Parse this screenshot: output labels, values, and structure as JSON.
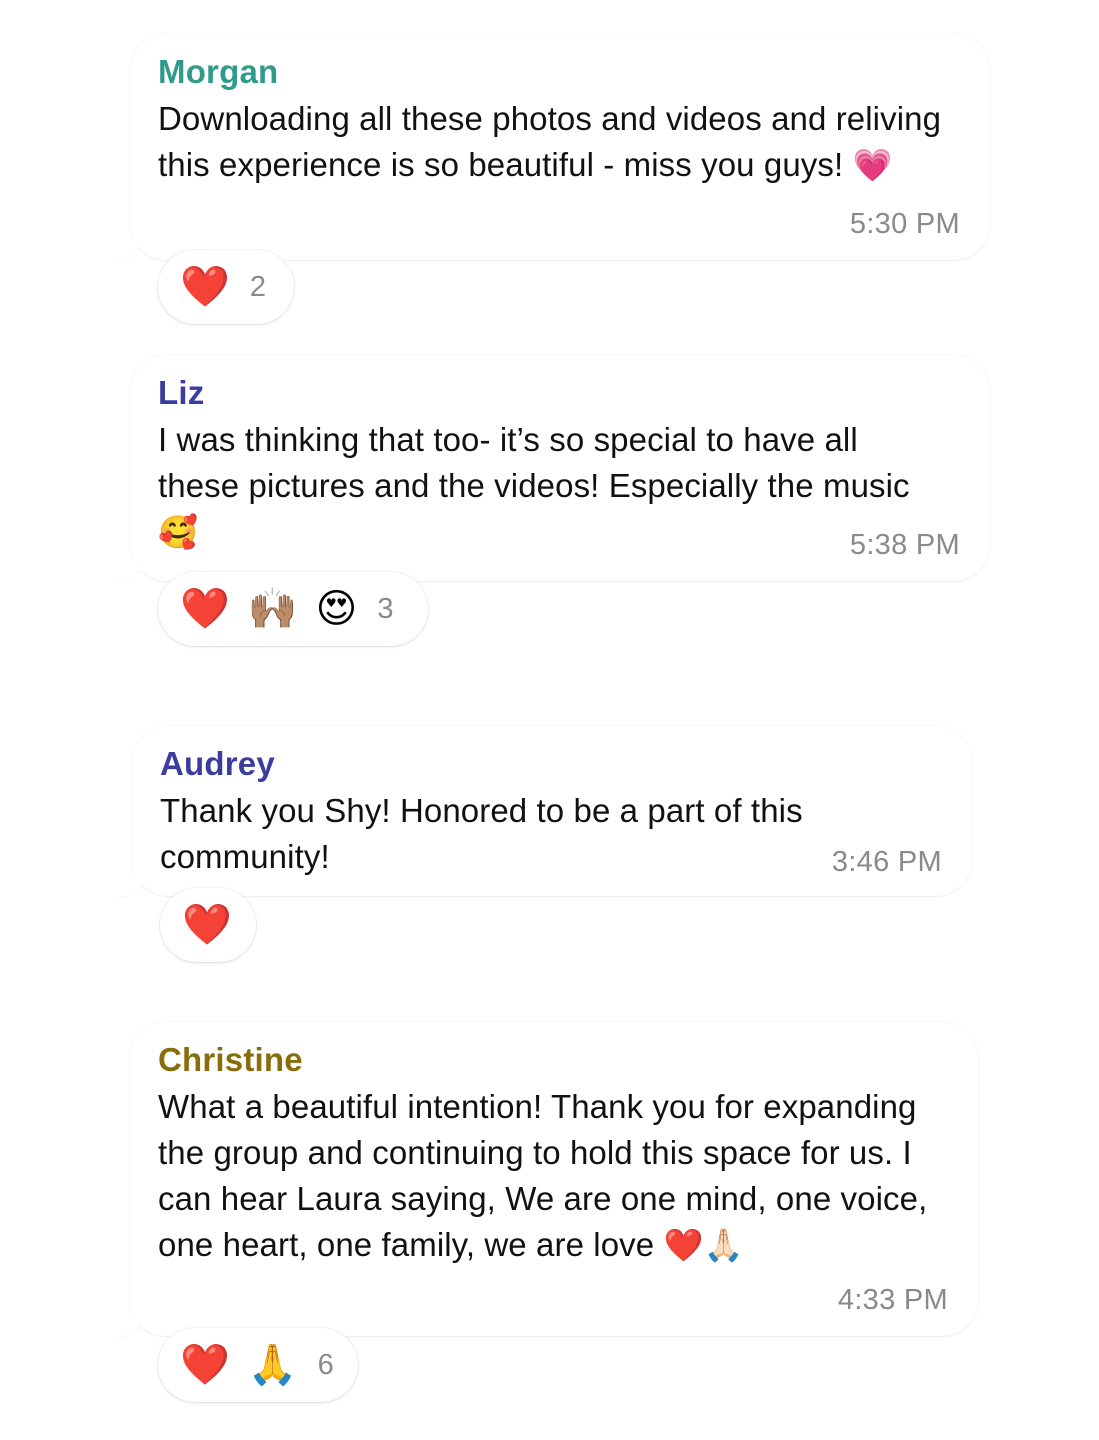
{
  "colors": {
    "morgan": "#2e9b8b",
    "liz": "#3a3d9e",
    "audrey": "#3a3d9e",
    "christine": "#8a6d0b"
  },
  "messages": [
    {
      "sender": "Morgan",
      "text": "Downloading all these photos and videos and reliving this experience is so beautiful - miss you guys!",
      "inline_emoji": "💗",
      "time": "5:30 PM",
      "reactions": [
        "❤️"
      ],
      "reaction_count": "2"
    },
    {
      "sender": "Liz",
      "text": "I was thinking that too- it’s so special to have all these pictures and the videos! Especially the music",
      "inline_emoji": "🥰",
      "time": "5:38 PM",
      "reactions": [
        "❤️",
        "🙌🏽",
        "😍"
      ],
      "reaction_count": "3"
    },
    {
      "sender": "Audrey",
      "text": "Thank you Shy! Honored to be a part of this community!",
      "inline_emoji": "",
      "time": "3:46 PM",
      "reactions": [
        "❤️"
      ],
      "reaction_count": ""
    },
    {
      "sender": "Christine",
      "text": "What a beautiful intention! Thank you for expanding the group and continuing to hold this space for us. I can hear Laura saying, We are one mind, one voice, one heart, one family, we are love",
      "inline_emoji": "❤️🙏🏻",
      "time": "4:33 PM",
      "reactions": [
        "❤️",
        "🙏"
      ],
      "reaction_count": "6"
    }
  ]
}
